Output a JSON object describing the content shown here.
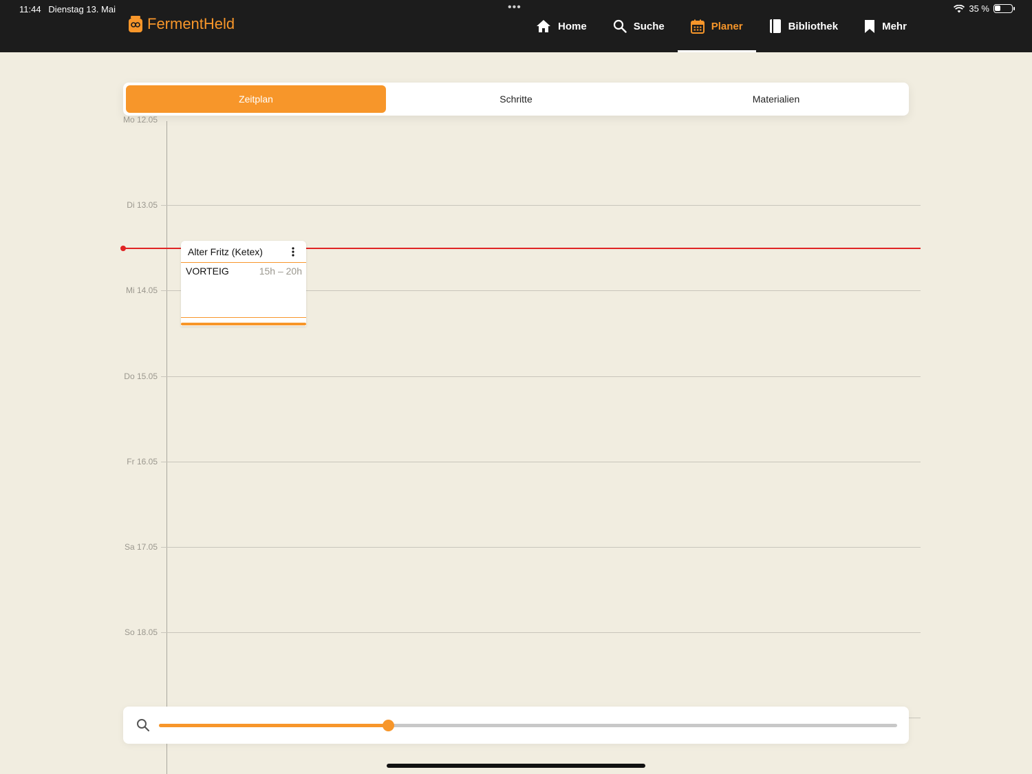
{
  "status": {
    "time": "11:44",
    "date": "Dienstag 13. Mai",
    "battery": "35 %",
    "battery_level": 0.35
  },
  "app": {
    "name": "FermentHeld",
    "brand_color": "#f7962a"
  },
  "nav": [
    {
      "label": "Home",
      "icon": "home-icon",
      "active": false
    },
    {
      "label": "Suche",
      "icon": "search-icon",
      "active": false
    },
    {
      "label": "Planer",
      "icon": "calendar-icon",
      "active": true
    },
    {
      "label": "Bibliothek",
      "icon": "book-icon",
      "active": false
    },
    {
      "label": "Mehr",
      "icon": "bookmark-icon",
      "active": false
    }
  ],
  "tabs": [
    {
      "label": "Zeitplan",
      "active": true
    },
    {
      "label": "Schritte",
      "active": false
    },
    {
      "label": "Materialien",
      "active": false
    }
  ],
  "days": [
    "Mo 12.05",
    "Di 13.05",
    "Mi 14.05",
    "Do 15.05",
    "Fr 16.05",
    "Sa 17.05",
    "So 18.05"
  ],
  "event": {
    "title": "Alter Fritz (Ketex)",
    "step": "VORTEIG",
    "duration": "15h – 20h"
  },
  "zoom": {
    "value": 0.31,
    "icon": "search-icon"
  },
  "now_line_color": "#e02424"
}
